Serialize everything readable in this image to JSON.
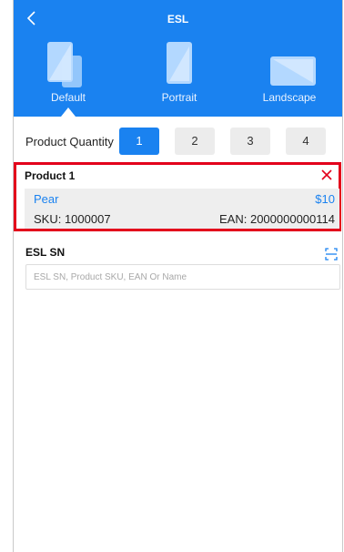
{
  "header": {
    "title": "ESL"
  },
  "layouts": [
    {
      "label": "Default",
      "selected": true
    },
    {
      "label": "Portrait",
      "selected": false
    },
    {
      "label": "Landscape",
      "selected": false
    }
  ],
  "quantity": {
    "label": "Product Quantity",
    "options": [
      "1",
      "2",
      "3",
      "4"
    ],
    "selected": "1"
  },
  "product": {
    "title": "Product 1",
    "name": "Pear",
    "price": "$10",
    "sku": "SKU: 1000007",
    "ean": "EAN: 2000000000114"
  },
  "esl": {
    "title": "ESL SN",
    "placeholder": "ESL SN, Product SKU, EAN Or Name"
  },
  "colors": {
    "accent": "#1a82f0",
    "highlight_border": "#e3001b",
    "info_bg": "#eeeeee"
  }
}
